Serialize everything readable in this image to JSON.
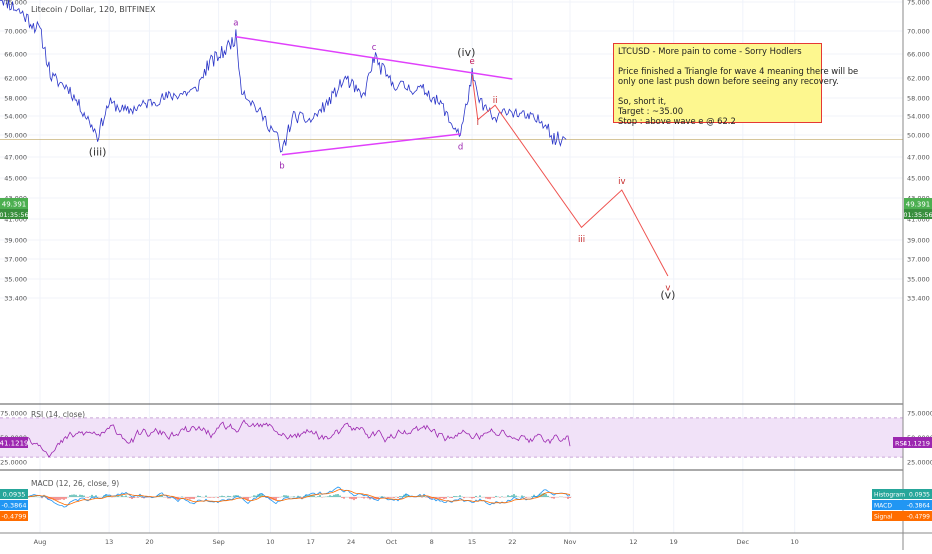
{
  "header": {
    "symbol_label": "Litecoin / Dollar, 120, BITFINEX"
  },
  "note": {
    "title": "LTCUSD - More pain to come - Sorry Hodlers",
    "line1": "Price finished a Triangle for wave 4 meaning there will be",
    "line2": "only one last push down before seeing any recovery.",
    "line3": "So, short it,",
    "line4": "Target : ~35.00",
    "line5": "Stop : above wave e @ 62.2"
  },
  "price_badge": {
    "value": "49.391",
    "countdown": "01:35:56"
  },
  "rsi_panel": {
    "label": "RSI (14, close)",
    "badge_value": "41.1219",
    "badge_prefix": "RSI"
  },
  "macd_panel": {
    "label": "MACD (12, 26, close, 9)",
    "left_values": [
      "0.0935",
      "-0.3864",
      "-0.4799"
    ],
    "right_badges": [
      {
        "name": "Histogram",
        "value": "0.0935"
      },
      {
        "name": "MACD",
        "value": "-0.3864"
      },
      {
        "name": "Signal",
        "value": "-0.4799"
      }
    ]
  },
  "colors": {
    "price": "#2a35c8",
    "triangle": "#e040fb",
    "projection": "#ef5350",
    "rsi": "#9c27b0",
    "rsi_band": "#f1e2f8",
    "macd": "#2196f3",
    "signal": "#ff6d00",
    "badge_green": "#4caf50",
    "badge_purple": "#9c27b0"
  },
  "chart_data": {
    "type": "line",
    "title": "Litecoin / Dollar, 120, BITFINEX",
    "y_ticks": [
      "75.000",
      "70.000",
      "66.000",
      "62.000",
      "58.000",
      "54.000",
      "50.000",
      "47.000",
      "45.000",
      "43.000",
      "41.000",
      "39.000",
      "37.000",
      "35.000",
      "33.400"
    ],
    "x_ticks": [
      "Aug",
      "13",
      "20",
      "Sep",
      "10",
      "17",
      "24",
      "Oct",
      "8",
      "15",
      "22",
      "Nov",
      "12",
      "19",
      "Dec",
      "10"
    ],
    "ylim": [
      31.5,
      76
    ],
    "last_price": 49.391,
    "price_path": [
      [
        "2018-07-25",
        76
      ],
      [
        "2018-07-29",
        73
      ],
      [
        "2018-08-01",
        70
      ],
      [
        "2018-08-03",
        62
      ],
      [
        "2018-08-06",
        60
      ],
      [
        "2018-08-10",
        52
      ],
      [
        "2018-08-11",
        50
      ],
      [
        "2018-08-13",
        57
      ],
      [
        "2018-08-16",
        55
      ],
      [
        "2018-08-20",
        57
      ],
      [
        "2018-08-24",
        58.5
      ],
      [
        "2018-08-28",
        59.5
      ],
      [
        "2018-08-30",
        64
      ],
      [
        "2018-09-02",
        66.5
      ],
      [
        "2018-09-04",
        69
      ],
      [
        "2018-09-05",
        60
      ],
      [
        "2018-09-08",
        55
      ],
      [
        "2018-09-11",
        50
      ],
      [
        "2018-09-12",
        47.3
      ],
      [
        "2018-09-14",
        54
      ],
      [
        "2018-09-17",
        53
      ],
      [
        "2018-09-20",
        57
      ],
      [
        "2018-09-23",
        62
      ],
      [
        "2018-09-26",
        58
      ],
      [
        "2018-09-28",
        65.5
      ],
      [
        "2018-10-01",
        61
      ],
      [
        "2018-10-04",
        60
      ],
      [
        "2018-10-07",
        59.5
      ],
      [
        "2018-10-10",
        56
      ],
      [
        "2018-10-11",
        53
      ],
      [
        "2018-10-13",
        50.2
      ],
      [
        "2018-10-15",
        62.5
      ],
      [
        "2018-10-16",
        58
      ],
      [
        "2018-10-19",
        53
      ],
      [
        "2018-10-21",
        55.5
      ],
      [
        "2018-10-24",
        54
      ],
      [
        "2018-10-28",
        52.5
      ],
      [
        "2018-10-29",
        49.5
      ],
      [
        "2018-10-31",
        49.4
      ]
    ],
    "annotations": [
      {
        "text": "(iii)",
        "date": "2018-08-11",
        "value": 47.6
      },
      {
        "text": "a",
        "date": "2018-09-04",
        "value": 71.5
      },
      {
        "text": "b",
        "date": "2018-09-12",
        "value": 46.2
      },
      {
        "text": "c",
        "date": "2018-09-28",
        "value": 67.2
      },
      {
        "text": "(iv)",
        "date": "2018-10-14",
        "value": 66.2
      },
      {
        "text": "e",
        "date": "2018-10-15",
        "value": 64.8
      },
      {
        "text": "d",
        "date": "2018-10-13",
        "value": 48.4
      },
      {
        "text": "i",
        "date": "2018-10-16",
        "value": 52.7
      },
      {
        "text": "ii",
        "date": "2018-10-19",
        "value": 57.6
      },
      {
        "text": "iii",
        "date": "2018-11-03",
        "value": 39.1
      },
      {
        "text": "iv",
        "date": "2018-11-10",
        "value": 44.7
      },
      {
        "text": "v",
        "date": "2018-11-18",
        "value": 34.3
      },
      {
        "text": "(v)",
        "date": "2018-11-18",
        "value": 33.6
      }
    ],
    "triangle_lines": [
      {
        "from": [
          "2018-09-04",
          69
        ],
        "to": [
          "2018-10-22",
          61.8
        ]
      },
      {
        "from": [
          "2018-09-12",
          47.3
        ],
        "to": [
          "2018-10-13",
          50.2
        ]
      }
    ],
    "projection": [
      [
        "2018-10-15",
        62.5
      ],
      [
        "2018-10-16",
        53.2
      ],
      [
        "2018-10-19",
        56.4
      ],
      [
        "2018-11-03",
        40.2
      ],
      [
        "2018-11-10",
        43.8
      ],
      [
        "2018-11-18",
        35.3
      ]
    ],
    "rsi": {
      "ylim": [
        15,
        82
      ],
      "ticks": [
        "75.0000",
        "50.0000",
        "25.0000"
      ],
      "band": [
        30,
        70
      ],
      "last": 41.1219
    },
    "macd": {
      "histogram": 0.0935,
      "macd": -0.3864,
      "signal": -0.4799
    }
  }
}
